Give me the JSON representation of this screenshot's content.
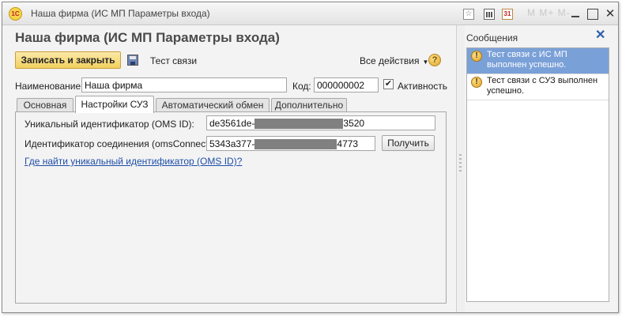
{
  "window": {
    "title": "Наша фирма (ИС МП Параметры входа)",
    "logo_text": "1С",
    "calendar_icon_text": "31",
    "star_icon_text": "☆",
    "memo_buttons": "M  M+ M-",
    "close_glyph": "✕"
  },
  "form": {
    "title": "Наша фирма (ИС МП Параметры входа)",
    "toolbar": {
      "save_close_label": "Записать и закрыть",
      "test_label": "Тест связи",
      "all_actions_label": "Все действия",
      "all_actions_caret": "▼",
      "help_glyph": "?"
    },
    "name_label": "Наименование:",
    "name_value": "Наша фирма",
    "code_label": "Код:",
    "code_value": "000000002",
    "active_label": "Активность",
    "active_checked": true,
    "active_check_glyph": "✔",
    "tabs": [
      {
        "label": "Основная",
        "active": false
      },
      {
        "label": "Настройки СУЗ",
        "active": true
      },
      {
        "label": "Автоматический обмен",
        "active": false
      },
      {
        "label": "Дополнительно",
        "active": false
      }
    ],
    "suz": {
      "oms_id_label": "Уникальный идентификатор (OMS ID):",
      "oms_id_prefix": "de3561de-",
      "oms_id_suffix": "3520",
      "connection_label": "Идентификатор соединения (omsConnection):",
      "connection_prefix": "5343a377-",
      "connection_suffix": "4773",
      "get_button_label": "Получить",
      "help_link": "Где найти уникальный идентификатор (OMS ID)?"
    }
  },
  "messages": {
    "title": "Сообщения",
    "close_glyph": "✕",
    "warn_glyph": "!",
    "items": [
      {
        "text": "Тест связи с ИС МП выполнен успешно.",
        "selected": true
      },
      {
        "text": "Тест связи с СУЗ выполнен успешно.",
        "selected": false
      }
    ]
  },
  "colors": {
    "accent_button": "#f2cf5e",
    "selected_message": "#7aa0d8",
    "link": "#1e4fa8",
    "close_icon": "#2a5fb0"
  }
}
